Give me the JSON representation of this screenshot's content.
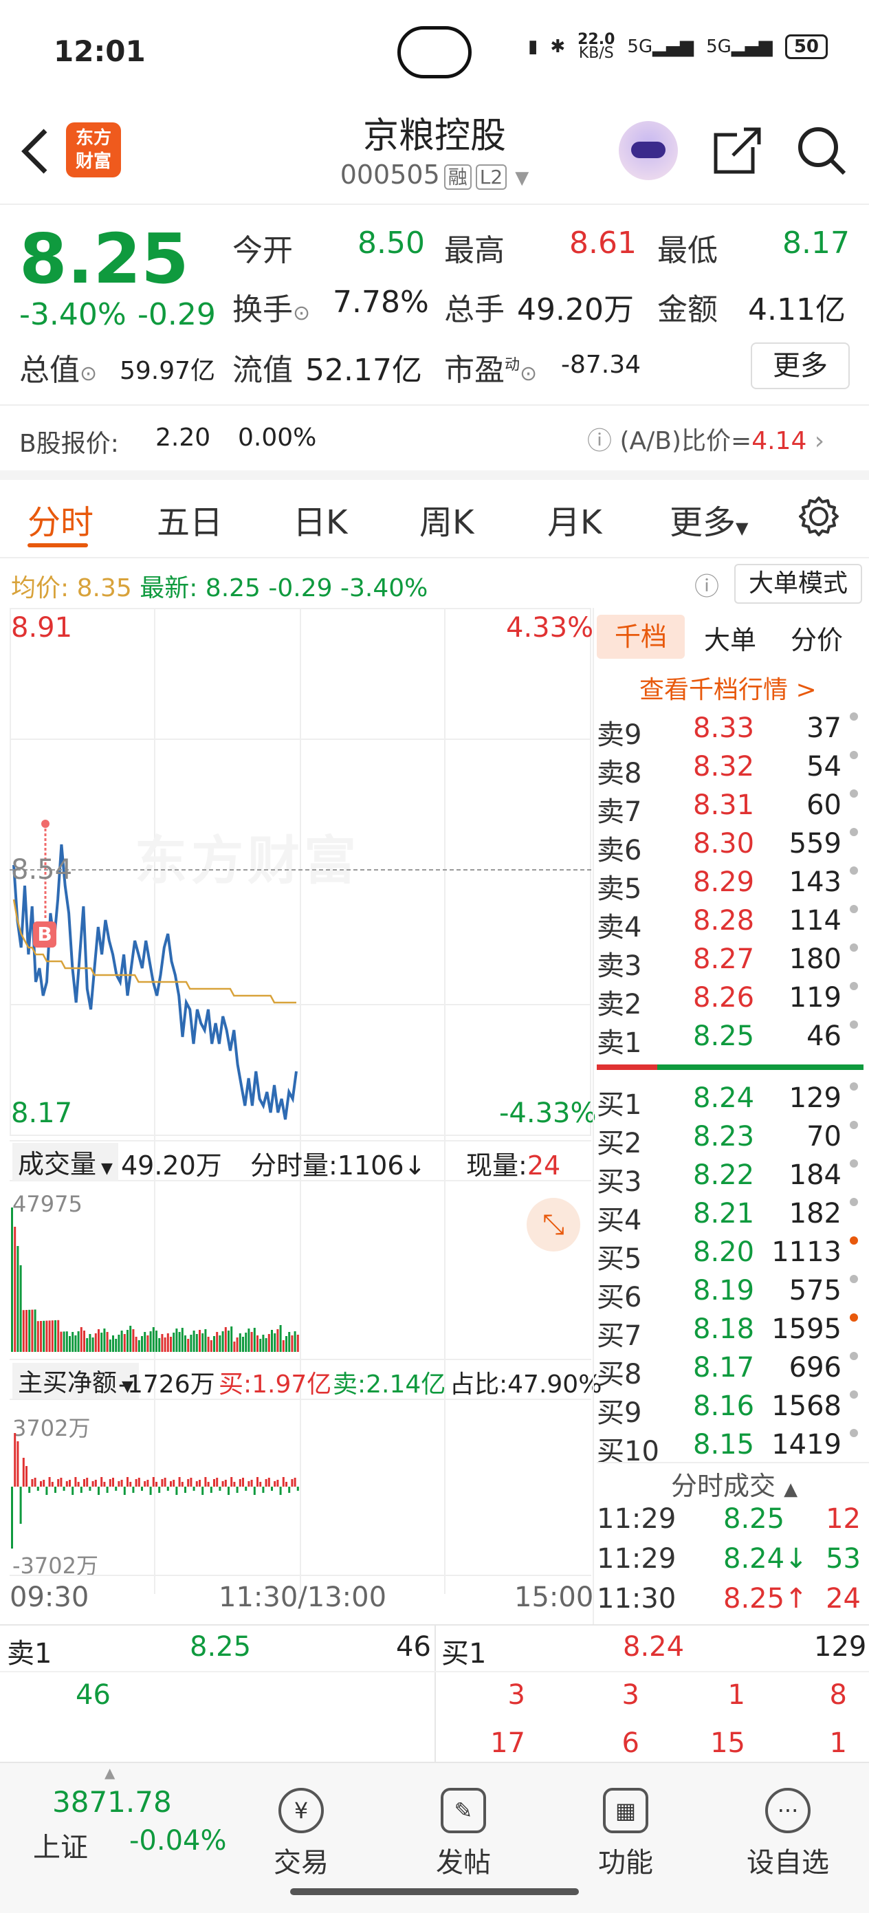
{
  "status": {
    "time": "12:01",
    "net": "22.0",
    "net_unit": "KB/S",
    "sig1": "5G",
    "sig2": "5G",
    "battery": "50"
  },
  "header": {
    "title": "京粮控股",
    "code": "000505",
    "tag_margin": "融",
    "tag_level": "L2",
    "logo_line1": "东方",
    "logo_line2": "财富"
  },
  "quote": {
    "price": "8.25",
    "change_pct": "-3.40%",
    "change": "-0.29",
    "open_label": "今开",
    "open": "8.50",
    "high_label": "最高",
    "high": "8.61",
    "low_label": "最低",
    "low": "8.17",
    "turnover_label": "换手",
    "turnover": "7.78%",
    "volume_label": "总手",
    "volume": "49.20万",
    "amount_label": "金额",
    "amount": "4.11亿",
    "mcap_label": "总值",
    "mcap": "59.97亿",
    "float_label": "流值",
    "float": "52.17亿",
    "pe_label": "市盈",
    "pe_sup": "动",
    "pe": "-87.34",
    "more": "更多"
  },
  "bshare": {
    "label": "B股报价:",
    "price": "2.20",
    "pct": "0.00%",
    "ratio_label": "(A/B)比价=",
    "ratio": "4.14"
  },
  "tabs": [
    "分时",
    "五日",
    "日K",
    "周K",
    "月K",
    "更多"
  ],
  "info_bar": {
    "avg_label": "均价:",
    "avg": "8.35",
    "latest_label": "最新:",
    "latest": "8.25",
    "chg": "-0.29",
    "pct": "-3.40%",
    "mode_btn": "大单模式"
  },
  "chart": {
    "top_price": "8.91",
    "top_pct": "4.33%",
    "mid_price": "8.54",
    "bot_price": "8.17",
    "bot_pct": "-4.33%",
    "watermark": "东方财富",
    "marker": "B",
    "vol_label": "成交量",
    "vol_total": "49.20万",
    "vol_tick_label": "分时量:1106↓",
    "vol_now_label": "现量:",
    "vol_now": "24",
    "vol_max": "47975",
    "flow_label": "主买净额",
    "flow_net": "-1726万",
    "flow_buy": "买:1.97亿",
    "flow_sell": "卖:2.14亿",
    "flow_ratio": "占比:47.90%",
    "flow_max": "3702万",
    "flow_min": "-3702万",
    "time_start": "09:30",
    "time_mid": "11:30/13:00",
    "time_end": "15:00"
  },
  "chart_data": {
    "type": "line",
    "title": "",
    "ylim": [
      8.17,
      8.91
    ],
    "series": [
      {
        "values": [
          8.55,
          8.47,
          8.43,
          8.52,
          8.42,
          8.49,
          8.38,
          8.4,
          8.36,
          8.38,
          8.48,
          8.44,
          8.5,
          8.58,
          8.52,
          8.48,
          8.4,
          8.35,
          8.42,
          8.49,
          8.37,
          8.34,
          8.4,
          8.46,
          8.42,
          8.47,
          8.44,
          8.42,
          8.39,
          8.38,
          8.42,
          8.36,
          8.4,
          8.44,
          8.42,
          8.4,
          8.44,
          8.41,
          8.38,
          8.36,
          8.39,
          8.43,
          8.45,
          8.41,
          8.39,
          8.36,
          8.3,
          8.35,
          8.34,
          8.29,
          8.34,
          8.32,
          8.31,
          8.34,
          8.29,
          8.32,
          8.29,
          8.33,
          8.31,
          8.28,
          8.31,
          8.26,
          8.23,
          8.2,
          8.24,
          8.2,
          8.25,
          8.21,
          8.2,
          8.22,
          8.19,
          8.23,
          8.19,
          8.21,
          8.18,
          8.22,
          8.21,
          8.25
        ]
      },
      {
        "values": [
          8.5,
          8.47,
          8.45,
          8.44,
          8.43,
          8.43,
          8.42,
          8.42,
          8.42,
          8.41,
          8.41,
          8.41,
          8.41,
          8.41,
          8.4,
          8.4,
          8.4,
          8.4,
          8.4,
          8.4,
          8.4,
          8.4,
          8.39,
          8.39,
          8.39,
          8.39,
          8.39,
          8.39,
          8.39,
          8.39,
          8.39,
          8.39,
          8.39,
          8.39,
          8.38,
          8.38,
          8.38,
          8.38,
          8.38,
          8.38,
          8.38,
          8.38,
          8.38,
          8.38,
          8.38,
          8.38,
          8.38,
          8.38,
          8.37,
          8.37,
          8.37,
          8.37,
          8.37,
          8.37,
          8.37,
          8.37,
          8.37,
          8.37,
          8.37,
          8.37,
          8.36,
          8.36,
          8.36,
          8.36,
          8.36,
          8.36,
          8.36,
          8.36,
          8.36,
          8.36,
          8.36,
          8.35,
          8.35,
          8.35,
          8.35,
          8.35,
          8.35,
          8.35
        ]
      }
    ],
    "colors": {
      "price": "#2e6bb3",
      "avg": "#d8a23a",
      "up": "#e03232",
      "down": "#0f9a3e"
    }
  },
  "orderbook": {
    "tabs": [
      "千档",
      "大单",
      "分价"
    ],
    "link": "查看千档行情 >",
    "asks": [
      {
        "label": "卖9",
        "price": "8.33",
        "vol": "37"
      },
      {
        "label": "卖8",
        "price": "8.32",
        "vol": "54"
      },
      {
        "label": "卖7",
        "price": "8.31",
        "vol": "60"
      },
      {
        "label": "卖6",
        "price": "8.30",
        "vol": "559"
      },
      {
        "label": "卖5",
        "price": "8.29",
        "vol": "143"
      },
      {
        "label": "卖4",
        "price": "8.28",
        "vol": "114"
      },
      {
        "label": "卖3",
        "price": "8.27",
        "vol": "180"
      },
      {
        "label": "卖2",
        "price": "8.26",
        "vol": "119"
      },
      {
        "label": "卖1",
        "price": "8.25",
        "vol": "46"
      }
    ],
    "bids": [
      {
        "label": "买1",
        "price": "8.24",
        "vol": "129"
      },
      {
        "label": "买2",
        "price": "8.23",
        "vol": "70"
      },
      {
        "label": "买3",
        "price": "8.22",
        "vol": "184"
      },
      {
        "label": "买4",
        "price": "8.21",
        "vol": "182"
      },
      {
        "label": "买5",
        "price": "8.20",
        "vol": "1113"
      },
      {
        "label": "买6",
        "price": "8.19",
        "vol": "575"
      },
      {
        "label": "买7",
        "price": "8.18",
        "vol": "1595"
      },
      {
        "label": "买8",
        "price": "8.17",
        "vol": "696"
      },
      {
        "label": "买9",
        "price": "8.16",
        "vol": "1568"
      },
      {
        "label": "买10",
        "price": "8.15",
        "vol": "1419"
      }
    ],
    "trades_title": "分时成交",
    "trades": [
      {
        "time": "11:29",
        "price": "8.25",
        "vol": "12"
      },
      {
        "time": "11:29",
        "price": "8.24↓",
        "vol": "53"
      },
      {
        "time": "11:30",
        "price": "8.25↑",
        "vol": "24"
      }
    ]
  },
  "queue": {
    "sell_label": "卖1",
    "sell_price": "8.25",
    "sell_vol": "46",
    "sell_items": [
      "46"
    ],
    "buy_label": "买1",
    "buy_price": "8.24",
    "buy_vol": "129",
    "buy_row1": [
      "3",
      "3",
      "1",
      "8"
    ],
    "buy_row2": [
      "17",
      "6",
      "15",
      "1"
    ]
  },
  "bottom_nav": {
    "index_value": "3871.78",
    "index_name": "上证",
    "index_pct": "-0.04%",
    "items": [
      {
        "label": "交易",
        "icon": "¥"
      },
      {
        "label": "发帖",
        "icon": "✎"
      },
      {
        "label": "功能",
        "icon": "▦"
      },
      {
        "label": "设自选",
        "icon": "···"
      }
    ]
  }
}
